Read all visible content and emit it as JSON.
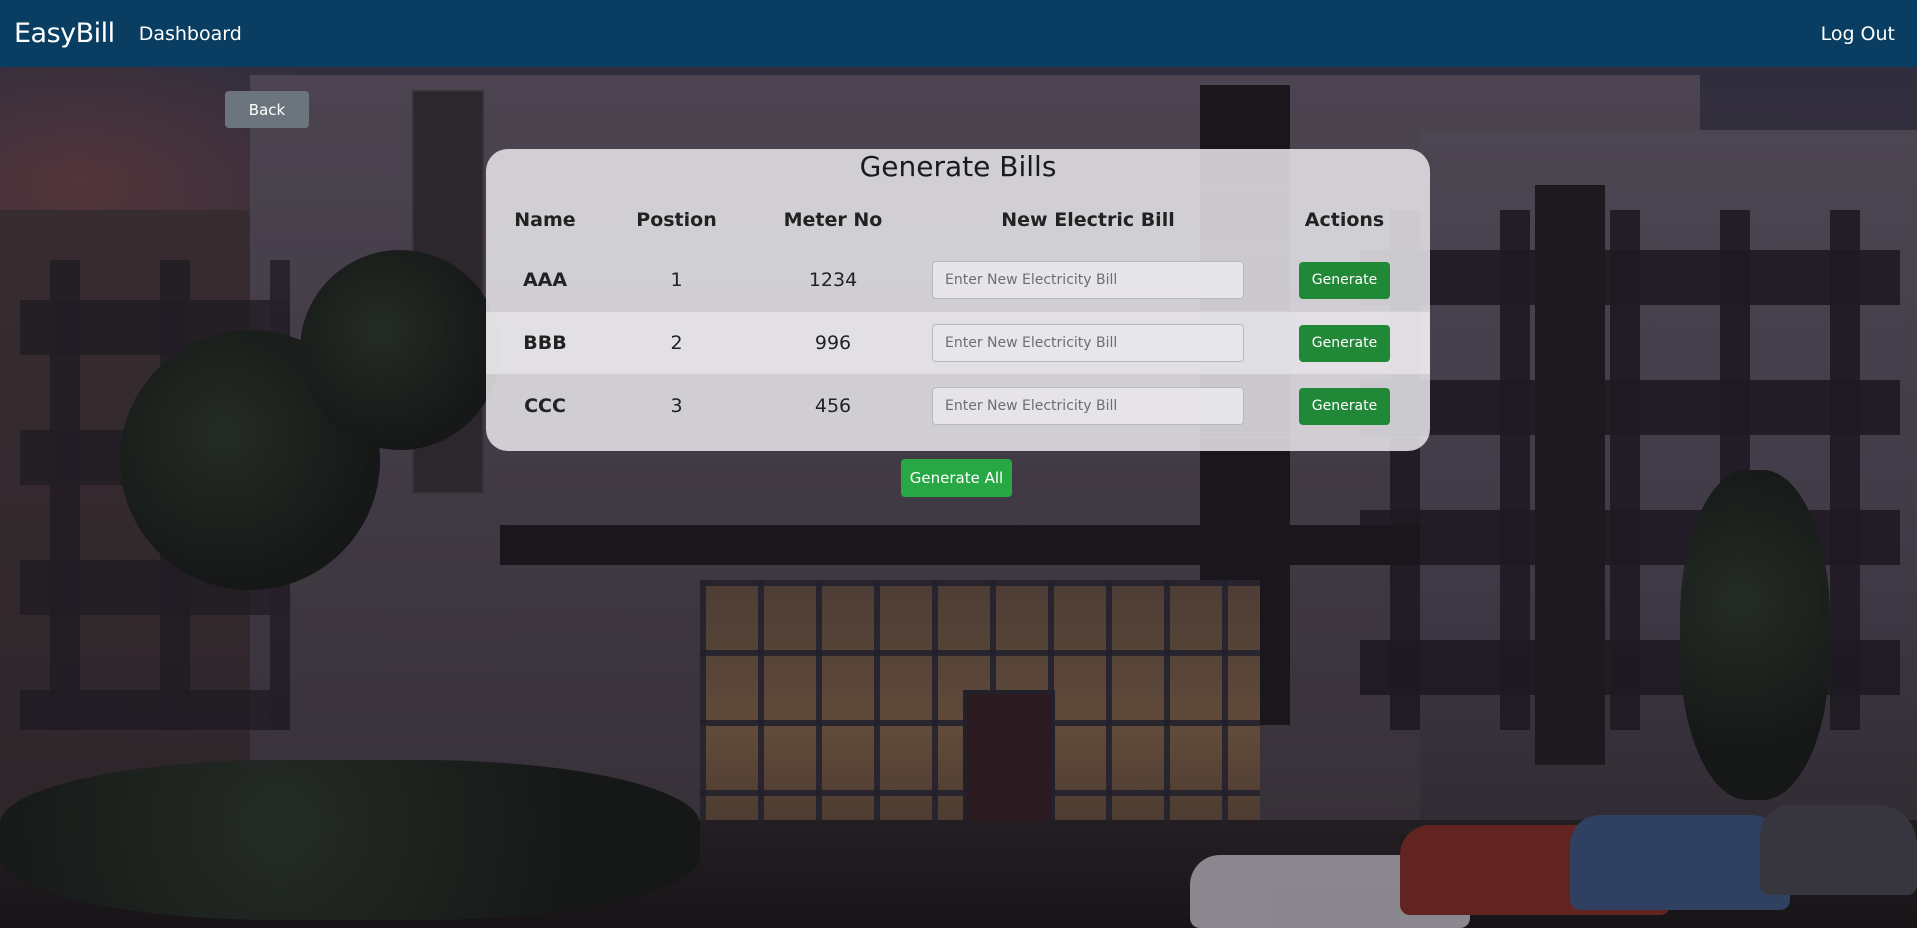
{
  "navbar": {
    "brand": "EasyBill",
    "dashboard_link": "Dashboard",
    "logout_link": "Log Out"
  },
  "back_button": "Back",
  "card": {
    "title": "Generate Bills",
    "columns": [
      "Name",
      "Postion",
      "Meter No",
      "New Electric Bill",
      "Actions"
    ],
    "rows": [
      {
        "name": "AAA",
        "position": "1",
        "meter_no": "1234",
        "bill_placeholder": "Enter New Electricity Bill",
        "action": "Generate"
      },
      {
        "name": "BBB",
        "position": "2",
        "meter_no": "996",
        "bill_placeholder": "Enter New Electricity Bill",
        "action": "Generate"
      },
      {
        "name": "CCC",
        "position": "3",
        "meter_no": "456",
        "bill_placeholder": "Enter New Electricity Bill",
        "action": "Generate"
      }
    ]
  },
  "generate_all_button": "Generate All",
  "colors": {
    "navbar": "#0a3d62",
    "generate_button": "#218838",
    "generate_all_button": "#28a745",
    "back_button": "#6c757d"
  }
}
